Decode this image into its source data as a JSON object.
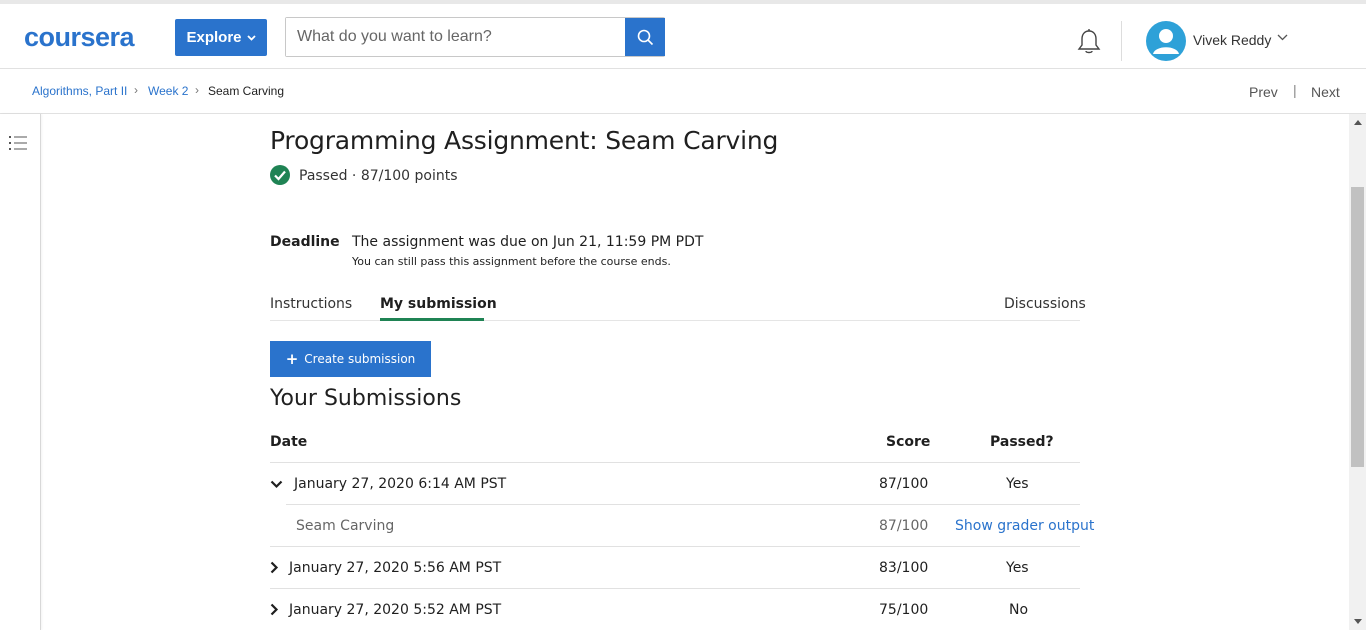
{
  "header": {
    "logo": "coursera",
    "explore_label": "Explore",
    "search_placeholder": "What do you want to learn?",
    "user_name": "Vivek Reddy"
  },
  "breadcrumb": {
    "items": [
      "Algorithms, Part II",
      "Week 2",
      "Seam Carving"
    ],
    "prev": "Prev",
    "next": "Next"
  },
  "assignment": {
    "title": "Programming Assignment: Seam Carving",
    "status": "Passed · 87/100 points",
    "deadline_label": "Deadline",
    "deadline_text": "The assignment was due on Jun 21, 11:59 PM PDT",
    "deadline_note": "You can still pass this assignment before the course ends."
  },
  "tabs": [
    {
      "label": "Instructions",
      "active": false
    },
    {
      "label": "My submission",
      "active": true
    },
    {
      "label": "Discussions",
      "active": false
    }
  ],
  "create_submission_label": "Create submission",
  "submissions": {
    "title": "Your Submissions",
    "columns": {
      "date": "Date",
      "score": "Score",
      "passed": "Passed?"
    },
    "rows": [
      {
        "date": "January 27, 2020 6:14 AM PST",
        "score": "87/100",
        "passed": "Yes",
        "expanded": true,
        "detail": {
          "name": "Seam Carving",
          "score": "87/100",
          "action": "Show grader output"
        }
      },
      {
        "date": "January 27, 2020 5:56 AM PST",
        "score": "83/100",
        "passed": "Yes",
        "expanded": false
      },
      {
        "date": "January 27, 2020 5:52 AM PST",
        "score": "75/100",
        "passed": "No",
        "expanded": false
      }
    ]
  },
  "colors": {
    "brand_blue": "#2a73cc",
    "success_green": "#1f8354"
  }
}
